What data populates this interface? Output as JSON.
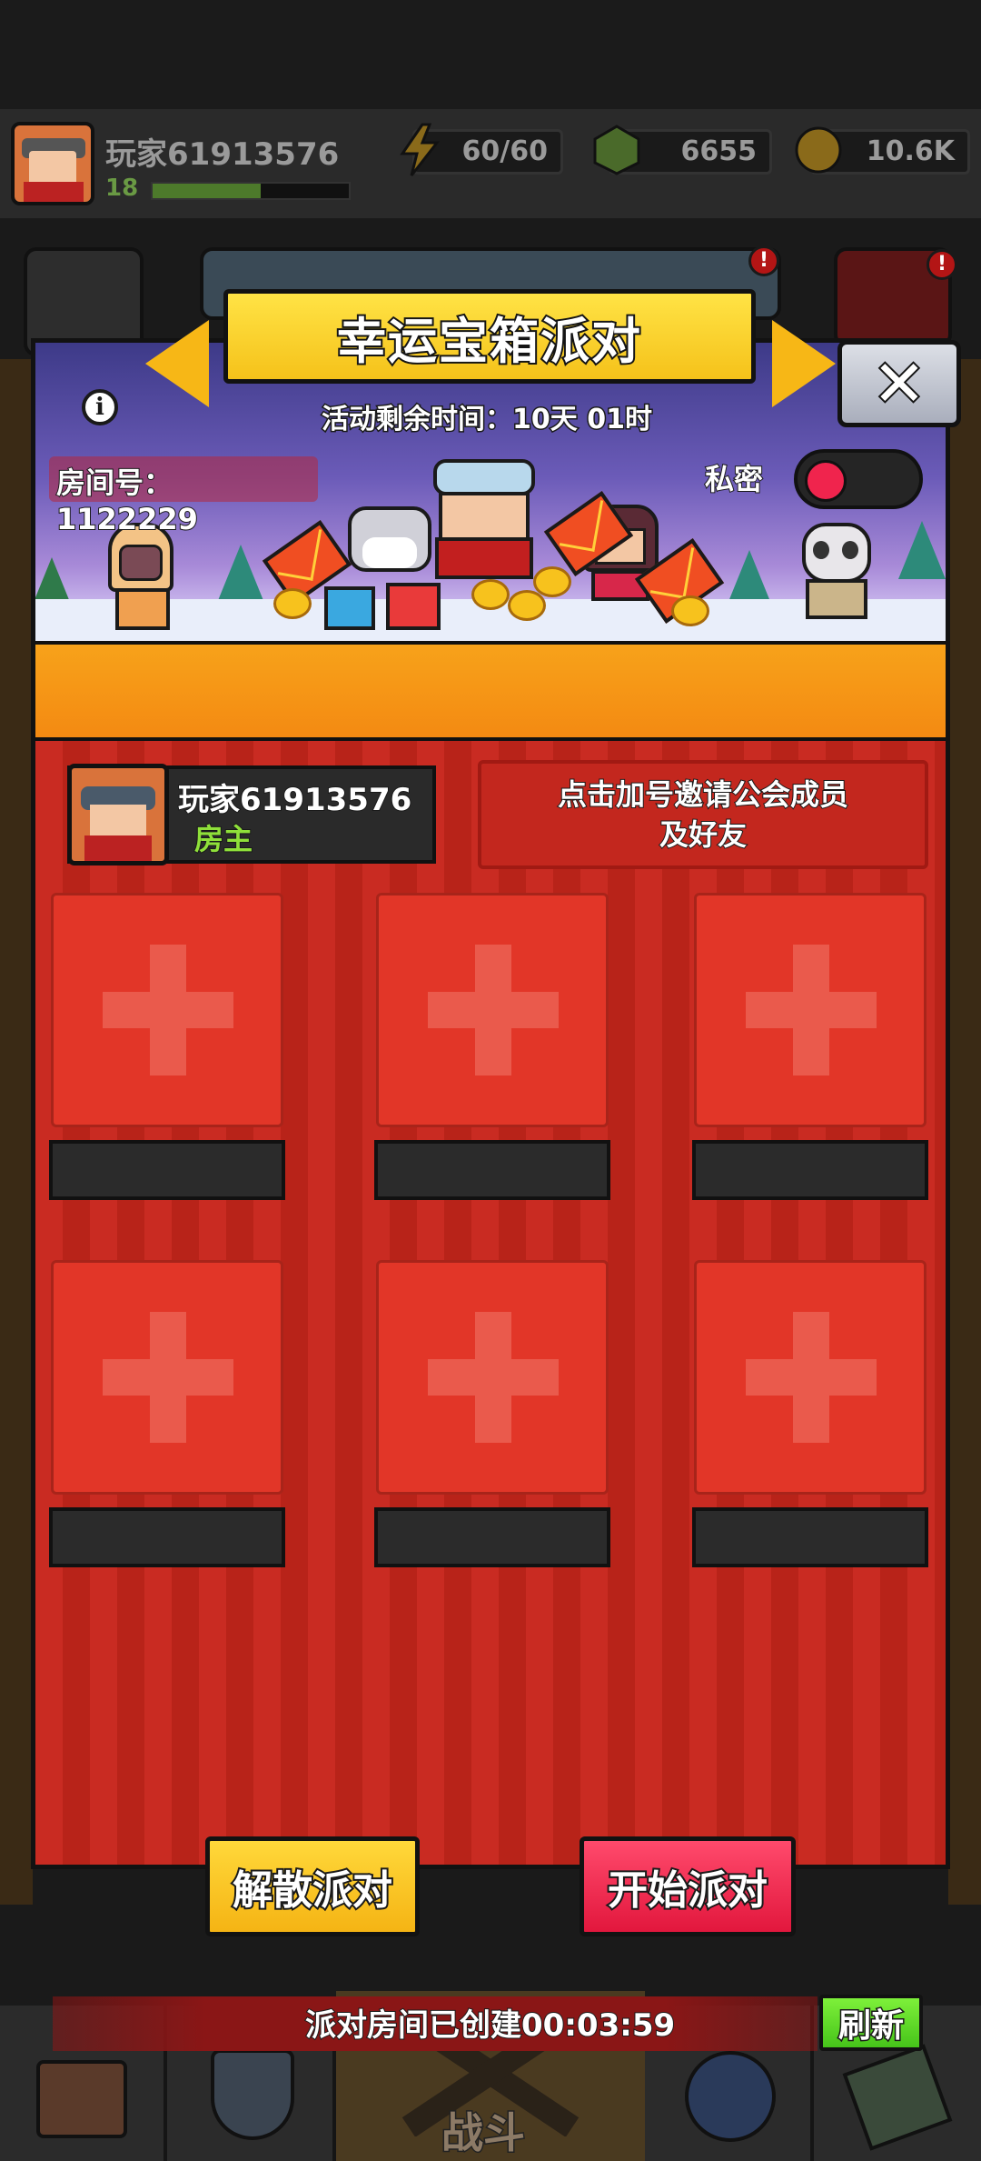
{
  "hud": {
    "player_name": "玩家61913576",
    "level": "18",
    "energy": "60/60",
    "gems": "6655",
    "gold": "10.6K"
  },
  "dialog": {
    "title": "幸运宝箱派对",
    "close_label": "✕",
    "info_icon": "i",
    "timer_text": "活动剩余时间：10天 01时",
    "room_number": "房间号：1122229",
    "private_label": "私密",
    "private_on": false,
    "host": {
      "name": "玩家61913576",
      "role": "房主"
    },
    "invite_line1": "点击加号邀请公会成员",
    "invite_line2": "及好友",
    "slots": [
      {
        "name": ""
      },
      {
        "name": ""
      },
      {
        "name": ""
      },
      {
        "name": ""
      },
      {
        "name": ""
      },
      {
        "name": ""
      }
    ],
    "disband_label": "解散派对",
    "start_label": "开始派对"
  },
  "status": {
    "created_text": "派对房间已创建00:03:59",
    "refresh_label": "刷新"
  },
  "bottom_nav": {
    "battle_label": "战斗"
  },
  "colors": {
    "title_yellow": "#f5c21a",
    "dialog_red": "#c4281f",
    "start_pink": "#e2173d",
    "refresh_green": "#46c41a",
    "toggle_knob": "#f0244d"
  }
}
